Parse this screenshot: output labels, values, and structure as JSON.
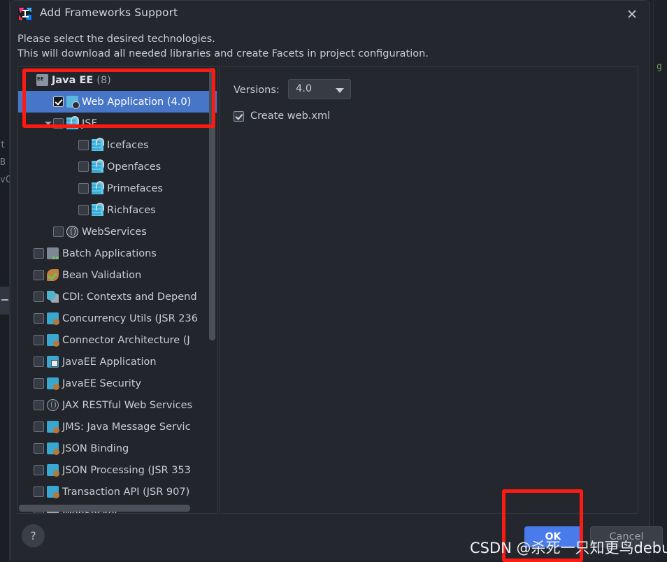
{
  "window": {
    "title": "Add Frameworks Support",
    "app_icon": "intellij-idea-icon",
    "close_icon": "✕"
  },
  "description": {
    "line1": "Please select the desired technologies.",
    "line2": "This will download all needed libraries and create Facets in project configuration."
  },
  "tree": {
    "items": [
      {
        "label": "Java EE",
        "count": "(8)",
        "type": "group",
        "icon": "ee-icon",
        "indent": 0,
        "checkbox": "none",
        "arrow": "none"
      },
      {
        "label": "Web Application (4.0)",
        "type": "item",
        "icon": "web-app-icon",
        "indent": 1,
        "checkbox": "checked",
        "arrow": "none",
        "selected": true
      },
      {
        "label": "JSF",
        "type": "item",
        "icon": "jsf-icon",
        "indent": 1,
        "checkbox": "unchecked",
        "arrow": "down"
      },
      {
        "label": "Icefaces",
        "type": "item",
        "icon": "jsf-icon",
        "indent": 2,
        "checkbox": "unchecked",
        "arrow": "none"
      },
      {
        "label": "Openfaces",
        "type": "item",
        "icon": "jsf-icon",
        "indent": 2,
        "checkbox": "unchecked",
        "arrow": "none"
      },
      {
        "label": "Primefaces",
        "type": "item",
        "icon": "jsf-icon",
        "indent": 2,
        "checkbox": "unchecked",
        "arrow": "none"
      },
      {
        "label": "Richfaces",
        "type": "item",
        "icon": "jsf-icon",
        "indent": 2,
        "checkbox": "unchecked",
        "arrow": "none"
      },
      {
        "label": "WebServices",
        "type": "item",
        "icon": "globe-icon",
        "indent": 1,
        "checkbox": "unchecked",
        "arrow": "none"
      },
      {
        "label": "Batch Applications",
        "type": "item",
        "icon": "folder-icon",
        "indent": 0,
        "checkbox": "unchecked",
        "arrow": "none"
      },
      {
        "label": "Bean Validation",
        "type": "item",
        "icon": "bean-icon",
        "indent": 0,
        "checkbox": "unchecked",
        "arrow": "none"
      },
      {
        "label": "CDI: Contexts and Depend",
        "type": "item",
        "icon": "cdi-icon",
        "indent": 0,
        "checkbox": "unchecked",
        "arrow": "none"
      },
      {
        "label": "Concurrency Utils (JSR 236",
        "type": "item",
        "icon": "javaee-icon",
        "indent": 0,
        "checkbox": "unchecked",
        "arrow": "none"
      },
      {
        "label": "Connector Architecture (J",
        "type": "item",
        "icon": "javaee-icon",
        "indent": 0,
        "checkbox": "unchecked",
        "arrow": "none"
      },
      {
        "label": "JavaEE Application",
        "type": "item",
        "icon": "javaee-app-icon",
        "indent": 0,
        "checkbox": "unchecked",
        "arrow": "none"
      },
      {
        "label": "JavaEE Security",
        "type": "item",
        "icon": "javaee-icon",
        "indent": 0,
        "checkbox": "unchecked",
        "arrow": "none"
      },
      {
        "label": "JAX RESTful Web Services",
        "type": "item",
        "icon": "globe-dark-icon",
        "indent": 0,
        "checkbox": "unchecked",
        "arrow": "none"
      },
      {
        "label": "JMS: Java Message Servic",
        "type": "item",
        "icon": "javaee-icon",
        "indent": 0,
        "checkbox": "unchecked",
        "arrow": "none"
      },
      {
        "label": "JSON Binding",
        "type": "item",
        "icon": "javaee-icon",
        "indent": 0,
        "checkbox": "unchecked",
        "arrow": "none"
      },
      {
        "label": "JSON Processing (JSR 353",
        "type": "item",
        "icon": "javaee-icon",
        "indent": 0,
        "checkbox": "unchecked",
        "arrow": "none"
      },
      {
        "label": "Transaction API (JSR 907)",
        "type": "item",
        "icon": "javaee-icon",
        "indent": 0,
        "checkbox": "unchecked",
        "arrow": "none"
      },
      {
        "label": "WebSocket",
        "type": "item",
        "icon": "websocket-icon",
        "indent": 0,
        "checkbox": "unchecked",
        "arrow": "none"
      }
    ]
  },
  "details": {
    "versions_label": "Versions:",
    "versions_value": "4.0",
    "create_webxml_label": "Create web.xml",
    "create_webxml_checked": true
  },
  "footer": {
    "help_label": "?",
    "ok_label": "OK",
    "cancel_label": "Cancel"
  },
  "watermark": {
    "text": "CSDN @杀死一只知更鸟debug"
  },
  "background": {
    "snippet1": "t",
    "snippet2": "B",
    "snippet3": "vC",
    "snippet_green": "g"
  },
  "colors": {
    "accent_blue": "#4a7bea",
    "selection_blue": "#4776c9",
    "annotation_red": "#fc1b12",
    "dialog_bg": "#24282e",
    "tree_bg": "#22262c"
  }
}
